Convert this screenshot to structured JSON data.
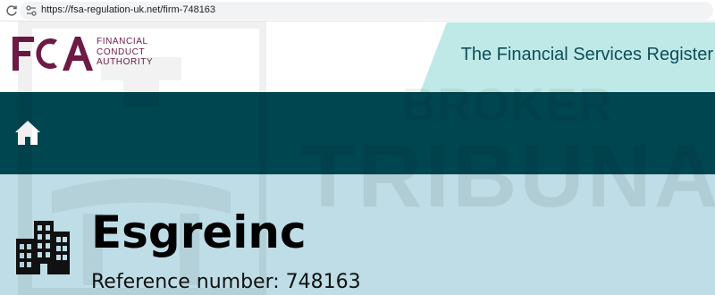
{
  "browser": {
    "url": "https://fsa-regulation-uk.net/firm-748163",
    "reload_icon": "reload-icon",
    "site_icon": "site-info-icon"
  },
  "header": {
    "logo_letters": "FCA",
    "logo_name_lines": [
      "FINANCIAL",
      "CONDUCT",
      "AUTHORITY"
    ],
    "register_title": "The Financial Services Register",
    "colors": {
      "logo": "#6d1a45",
      "banner": "#bfe9e6",
      "title": "#0d4e5a"
    }
  },
  "nav": {
    "home_icon": "home-icon",
    "color": "#004651"
  },
  "watermark": {
    "line1": "BROKER",
    "line2": "TRIBUNAL"
  },
  "firm": {
    "icon": "building-icon",
    "name": "Esgreinc",
    "reference_label": "Reference number:",
    "reference_number": "748163",
    "background": "#bedde6"
  }
}
